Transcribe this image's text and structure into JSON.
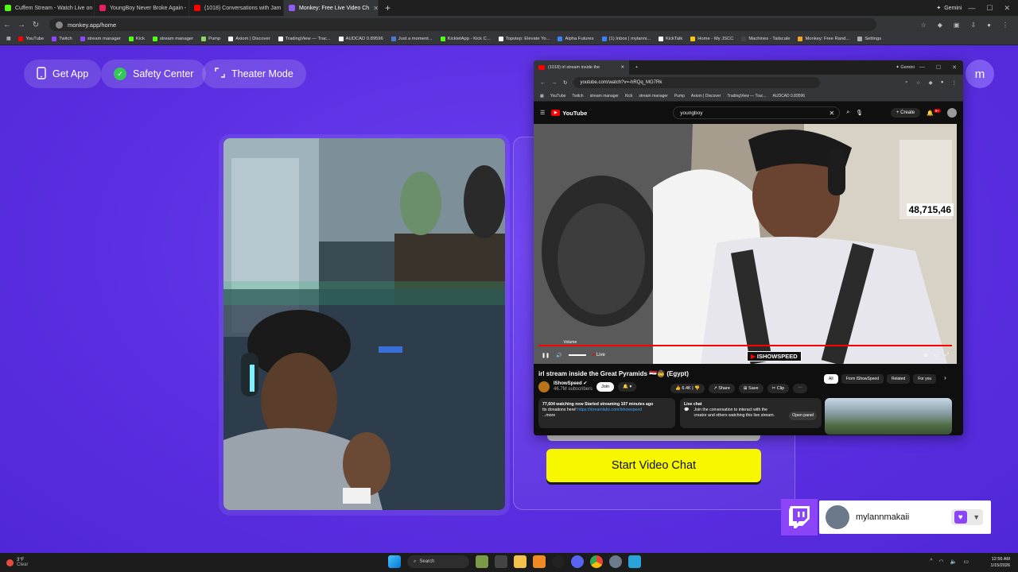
{
  "browser": {
    "tabs": [
      {
        "title": "Cuffem Stream - Watch Live on",
        "color": "#53fc18"
      },
      {
        "title": "YoungBoy Never Broke Again -",
        "color": "#e91e63"
      },
      {
        "title": "(1018) Conversations with Jam",
        "color": "#ff0000"
      },
      {
        "title": "Monkey: Free Live Video Ch",
        "color": "#8e5cf7",
        "active": true
      }
    ],
    "gemini_label": "Gemini",
    "url": "monkey.app/home",
    "bookmarks": [
      {
        "label": "YouTube",
        "color": "#ff0000"
      },
      {
        "label": "Twitch",
        "color": "#9146ff"
      },
      {
        "label": "stream manager",
        "color": "#9146ff"
      },
      {
        "label": "Kick",
        "color": "#53fc18"
      },
      {
        "label": "stream manager",
        "color": "#53fc18"
      },
      {
        "label": "Pump",
        "color": "#8bd66b"
      },
      {
        "label": "Axiom | Discover",
        "color": "#ffffff"
      },
      {
        "label": "TradingView — Trac...",
        "color": "#ffffff"
      },
      {
        "label": "AUDCAD 0.89596",
        "color": "#ffffff"
      },
      {
        "label": "Just a moment...",
        "color": "#4a7bd1"
      },
      {
        "label": "KickletApp - Kick C...",
        "color": "#53fc18"
      },
      {
        "label": "Topstep: Elevate Yo...",
        "color": "#ffffff"
      },
      {
        "label": "Alpha Futures",
        "color": "#3b82f6"
      },
      {
        "label": "(1) Inbox | mylanni...",
        "color": "#3b82f6"
      },
      {
        "label": "KickTalk",
        "color": "#ffffff"
      },
      {
        "label": "Home - My JSCC",
        "color": "#f5c518"
      },
      {
        "label": "Machines - Tailscale",
        "color": "#444444"
      },
      {
        "label": "Monkey: Free Rand...",
        "color": "#f5a623"
      },
      {
        "label": "Settings",
        "color": "#aaaaaa"
      }
    ]
  },
  "monkey": {
    "get_app": "Get App",
    "safety_center": "Safety Center",
    "theater_mode": "Theater Mode",
    "avatar_letter": "m",
    "start_video_chat": "Start Video Chat"
  },
  "inner_window": {
    "tab_title": "(1018) irl stream inside the",
    "gemini_label": "Gemini",
    "url": "youtube.com/watch?v=-hRQq_MG7Rk",
    "bookmarks": [
      "YouTube",
      "Twitch",
      "stream manager",
      "Kick",
      "stream manager",
      "Pump",
      "Axiom | Discover",
      "TradingView — Trac...",
      "AUDCAD 0.89596"
    ]
  },
  "youtube": {
    "logo_text": "YouTube",
    "search_value": "youngboy",
    "create_label": "Create",
    "notif_count": "9+",
    "viewer_counter": "48,715,46",
    "volume_tooltip": "Volume",
    "live_label": "Live",
    "overlay_logo": "ISHOWSPEED",
    "video_title": "irl stream inside the Great Pyramids 🇪🇬🤠 (Egypt)",
    "channel_name": "IShowSpeed",
    "subscribers": "46.7M subscribers",
    "join_label": "Join",
    "likes": "6.4K",
    "share_label": "Share",
    "save_label": "Save",
    "clip_label": "Clip",
    "chips": [
      "All",
      "From IShowSpeed",
      "Related",
      "For you"
    ],
    "description_stats": "77,604 watching now  Started streaming 107 minutes ago",
    "description_line2": "tts donations here!",
    "description_link": "https://streamlabs.com/ishowspeed",
    "description_more": "...more",
    "live_chat_title": "Live chat",
    "live_chat_text": "Join the conversation to interact with the creator and others watching this live stream.",
    "open_panel": "Open panel"
  },
  "twitch_overlay": {
    "username": "mylannmakaii"
  },
  "taskbar": {
    "temperature": "3°F",
    "condition": "Clear",
    "search_placeholder": "Search",
    "time": "12:56 AM",
    "date": "1/15/2026"
  }
}
